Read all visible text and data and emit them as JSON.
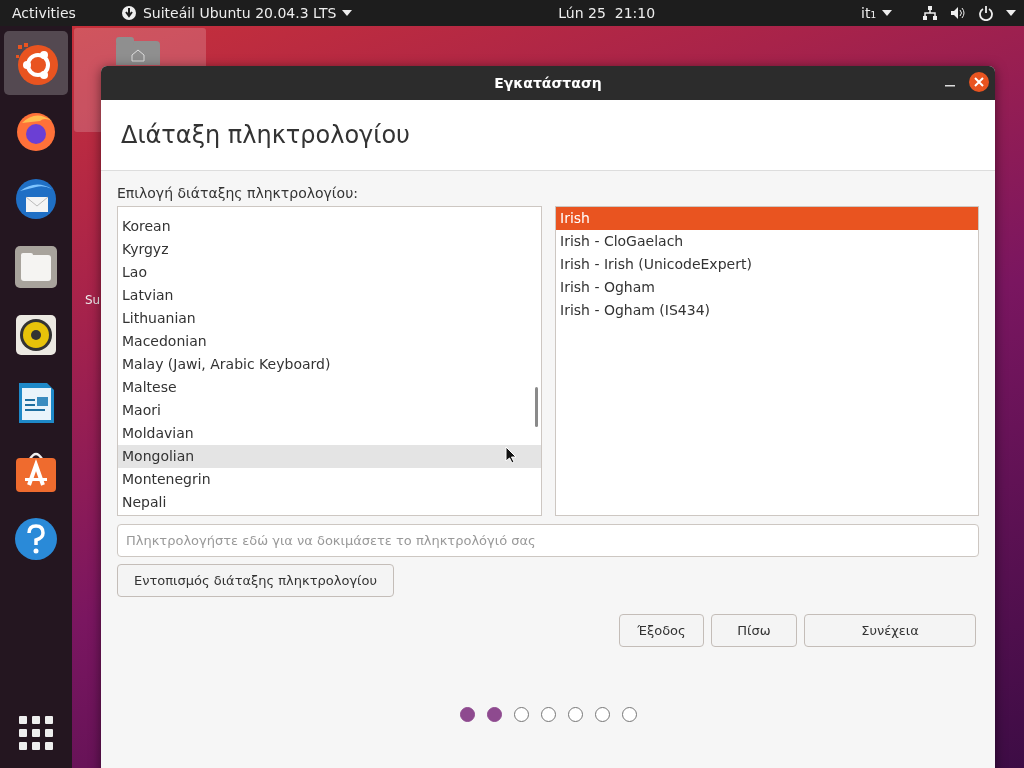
{
  "top_bar": {
    "activities": "Activities",
    "app_menu": "Suiteáil Ubuntu 20.04.3 LTS",
    "clock": "Lún 25  21:10",
    "input_source": "it₁"
  },
  "dock": {
    "items": [
      {
        "kind": "ubuntu",
        "selected": true
      },
      {
        "kind": "firefox",
        "selected": false
      },
      {
        "kind": "mail",
        "selected": false
      },
      {
        "kind": "files",
        "selected": false
      },
      {
        "kind": "music",
        "selected": false
      },
      {
        "kind": "writer",
        "selected": false
      },
      {
        "kind": "store",
        "selected": false
      },
      {
        "kind": "help",
        "selected": false
      }
    ]
  },
  "desktop": {
    "icon_label": "Su"
  },
  "window": {
    "title": "Εγκατάσταση",
    "heading": "Διάταξη πληκτρολογίου",
    "list_label": "Επιλογή διάταξης πληκτρολογίου:",
    "layouts": {
      "focused": false,
      "items": [
        {
          "label": "Korean",
          "selected": false
        },
        {
          "label": "Kyrgyz",
          "selected": false
        },
        {
          "label": "Lao",
          "selected": false
        },
        {
          "label": "Latvian",
          "selected": false
        },
        {
          "label": "Lithuanian",
          "selected": false
        },
        {
          "label": "Macedonian",
          "selected": false
        },
        {
          "label": "Malay (Jawi, Arabic Keyboard)",
          "selected": false
        },
        {
          "label": "Maltese",
          "selected": false
        },
        {
          "label": "Maori",
          "selected": false
        },
        {
          "label": "Moldavian",
          "selected": false
        },
        {
          "label": "Mongolian",
          "selected": true
        },
        {
          "label": "Montenegrin",
          "selected": false
        },
        {
          "label": "Nepali",
          "selected": false
        }
      ]
    },
    "variants": {
      "focused": true,
      "items": [
        {
          "label": "Irish",
          "selected": true
        },
        {
          "label": "Irish - CloGaelach",
          "selected": false
        },
        {
          "label": "Irish - Irish (UnicodeExpert)",
          "selected": false
        },
        {
          "label": "Irish - Ogham",
          "selected": false
        },
        {
          "label": "Irish - Ogham (IS434)",
          "selected": false
        }
      ]
    },
    "test_field": {
      "placeholder": "Πληκτρολογήστε εδώ για να δοκιμάσετε το πληκτρολόγιό σας"
    },
    "detect_button": "Εντοπισμός διάταξης πληκτρολογίου",
    "buttons": [
      "Έξοδος",
      "Πίσω",
      "Συνέχεια"
    ],
    "steps": [
      {
        "done": true
      },
      {
        "done": true
      },
      {
        "done": false
      },
      {
        "done": false
      },
      {
        "done": false
      },
      {
        "done": false
      },
      {
        "done": false
      }
    ]
  }
}
